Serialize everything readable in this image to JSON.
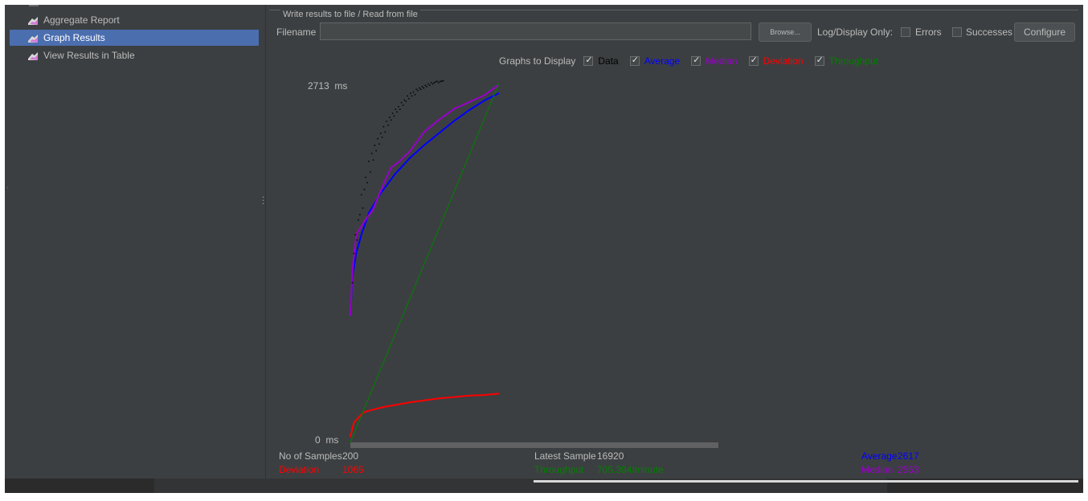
{
  "sidebar": {
    "items": [
      {
        "label": "Aggregate Report",
        "selected": false
      },
      {
        "label": "Graph Results",
        "selected": true
      },
      {
        "label": "View Results in Table",
        "selected": false
      }
    ]
  },
  "file_group": {
    "title": "Write results to file / Read from file",
    "filename_label": "Filename",
    "filename_value": "",
    "browse_label": "Browse...",
    "log_display_label": "Log/Display Only:",
    "errors_label": "Errors",
    "errors_checked": false,
    "successes_label": "Successes",
    "successes_checked": false,
    "configure_label": "Configure"
  },
  "graphs_to_display": {
    "title": "Graphs to Display",
    "items": [
      {
        "label": "Data",
        "checked": true,
        "color": "#000000"
      },
      {
        "label": "Average",
        "checked": true,
        "color": "#0000ff"
      },
      {
        "label": "Median",
        "checked": true,
        "color": "#9900cc"
      },
      {
        "label": "Deviation",
        "checked": true,
        "color": "#ff0000"
      },
      {
        "label": "Throughput",
        "checked": true,
        "color": "#008000"
      }
    ]
  },
  "chart_data": {
    "type": "line",
    "y_max_label": "2713",
    "y_min_label": "0",
    "y_unit": "ms",
    "ylim": [
      0,
      2713
    ],
    "xlim": [
      0,
      200
    ],
    "series": [
      {
        "name": "Average",
        "color": "#0000ff",
        "x": [
          0,
          3,
          8,
          15,
          25,
          40,
          60,
          80,
          100,
          120,
          140,
          160,
          180,
          200
        ],
        "y": [
          950,
          1250,
          1420,
          1560,
          1720,
          1860,
          2010,
          2130,
          2230,
          2320,
          2410,
          2490,
          2560,
          2617
        ]
      },
      {
        "name": "Median",
        "color": "#9900cc",
        "x": [
          0,
          3,
          8,
          15,
          22,
          30,
          45,
          55,
          65,
          80,
          100,
          120,
          140,
          160,
          180,
          200
        ],
        "y": [
          950,
          1300,
          1560,
          1620,
          1680,
          1740,
          1940,
          2060,
          2100,
          2180,
          2330,
          2420,
          2500,
          2550,
          2600,
          2680
        ]
      },
      {
        "name": "Deviation",
        "color": "#ff0000",
        "x": [
          0,
          3,
          5,
          10,
          15,
          20,
          30,
          45,
          60,
          80,
          100,
          120,
          140,
          160,
          180,
          200
        ],
        "y": [
          40,
          110,
          150,
          180,
          210,
          230,
          245,
          265,
          280,
          300,
          315,
          330,
          340,
          350,
          355,
          365
        ]
      },
      {
        "name": "Throughput",
        "color": "#008000",
        "x": [
          0,
          200
        ],
        "y": [
          0,
          2690
        ]
      },
      {
        "name": "Data",
        "color": "#000000",
        "x": [
          2,
          4,
          6,
          8,
          10,
          12,
          14,
          16,
          18,
          20,
          22,
          24,
          26,
          28,
          30,
          32,
          34,
          36,
          38,
          40,
          42,
          44,
          46,
          48,
          50,
          52,
          54,
          56,
          58,
          60,
          62,
          64,
          66,
          68,
          70,
          72,
          74,
          76,
          78,
          80,
          82,
          84,
          86,
          88,
          90,
          92,
          94,
          96,
          98,
          100,
          102,
          104,
          106,
          108,
          110,
          112,
          114,
          116,
          118,
          120,
          122,
          124
        ],
        "y": [
          1200,
          1420,
          1560,
          1520,
          1670,
          1710,
          1860,
          1760,
          1900,
          1990,
          1950,
          2110,
          2030,
          2170,
          2120,
          2230,
          2190,
          2280,
          2240,
          2320,
          2290,
          2370,
          2330,
          2410,
          2380,
          2440,
          2420,
          2470,
          2450,
          2500,
          2480,
          2520,
          2500,
          2550,
          2530,
          2570,
          2560,
          2600,
          2580,
          2620,
          2600,
          2630,
          2610,
          2650,
          2640,
          2660,
          2650,
          2670,
          2660,
          2680,
          2670,
          2690,
          2680,
          2700,
          2690,
          2700,
          2705,
          2710,
          2700,
          2708,
          2712,
          2713
        ]
      }
    ]
  },
  "stats": {
    "samples_label": "No of Samples",
    "samples_value": "200",
    "latest_label": "Latest Sample",
    "latest_value": "16920",
    "average_label": "Average",
    "average_value": "2617",
    "deviation_label": "Deviation",
    "deviation_value": "1065",
    "throughput_label": "Throughput",
    "throughput_value": "705.394/minute",
    "median_label": "Median",
    "median_value": "2553"
  },
  "colors": {
    "background": "#3c3f41",
    "selection": "#4b6eaf",
    "average": "#0000ff",
    "median": "#9900cc",
    "deviation": "#ff0000",
    "throughput": "#008000",
    "data": "#000000"
  }
}
